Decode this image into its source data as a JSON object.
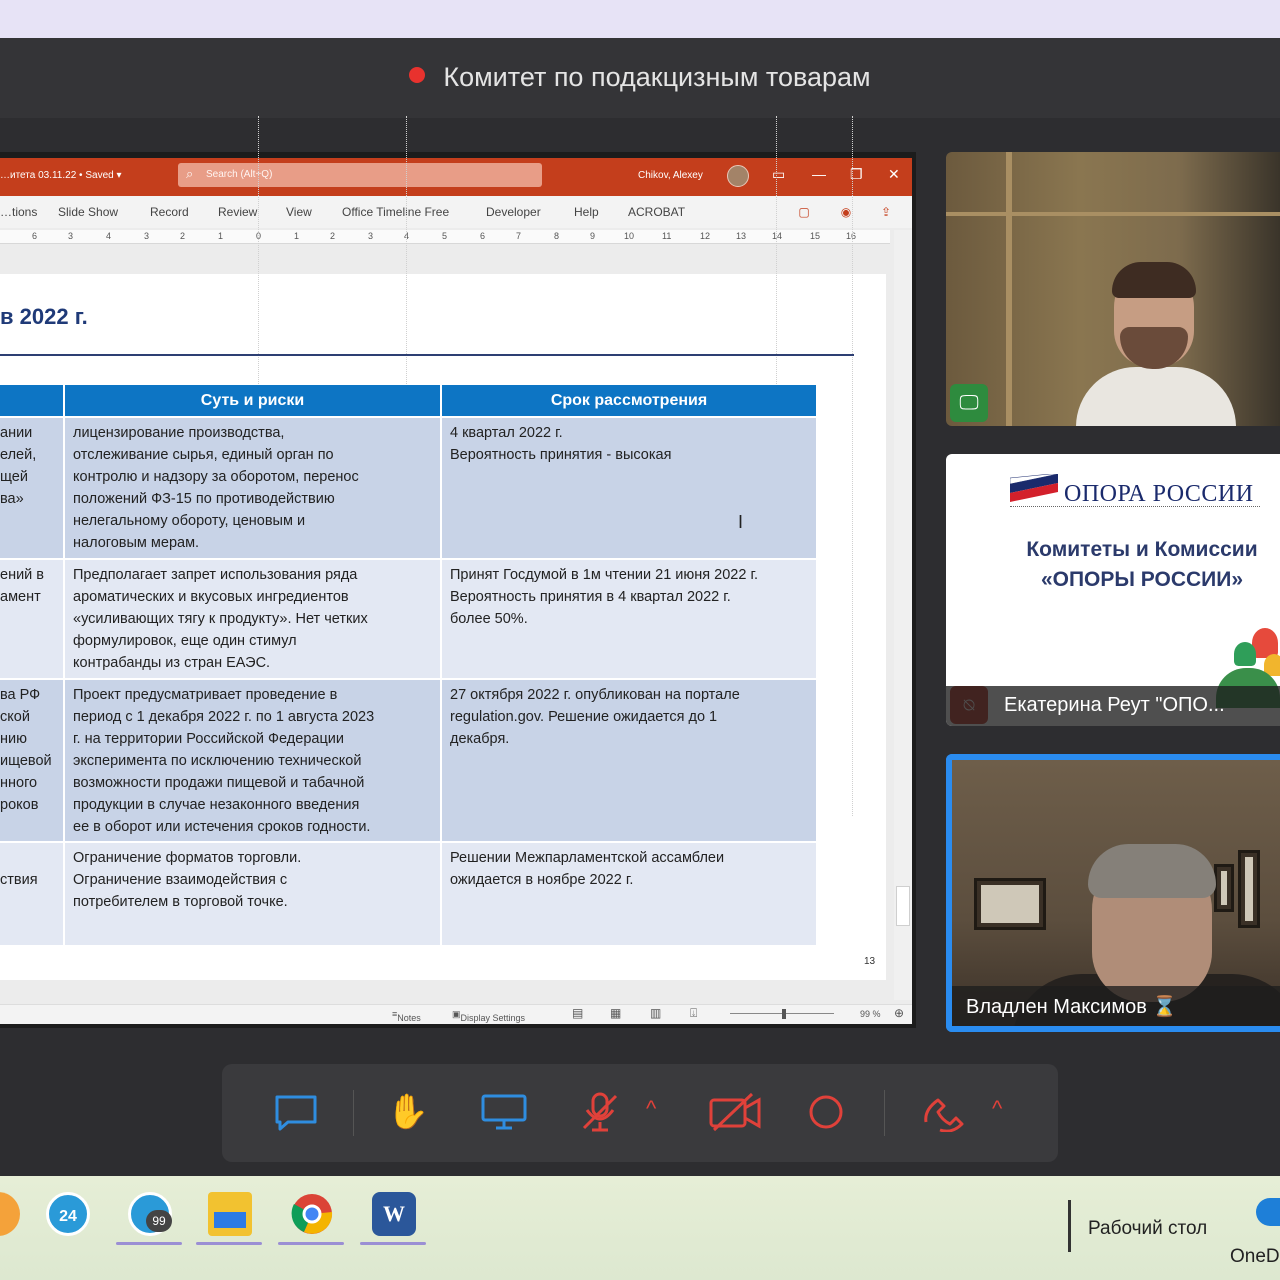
{
  "meeting": {
    "title": "Комитет по подакцизным товарам"
  },
  "powerpoint": {
    "file_name": "…итета 03.11.22 • Saved ▾",
    "search_placeholder": "Search (Alt+Q)",
    "user_name": "Chikov, Alexey",
    "menu": [
      "…tions",
      "Slide Show",
      "Record",
      "Review",
      "View",
      "Office Timeline Free",
      "Developer",
      "Help",
      "ACROBAT"
    ],
    "ruler_ticks": [
      "6",
      "3",
      "4",
      "3",
      "2",
      "1",
      "0",
      "1",
      "2",
      "3",
      "4",
      "5",
      "6",
      "7",
      "8",
      "9",
      "10",
      "11",
      "12",
      "13",
      "14",
      "15",
      "16"
    ],
    "status": {
      "notes": "Notes",
      "display_settings": "Display Settings",
      "zoom": "99 %"
    },
    "page_number": "13"
  },
  "slide": {
    "heading": "в 2022 г.",
    "columns": [
      "",
      "Суть и риски",
      "Срок рассмотрения"
    ],
    "rows": [
      {
        "c0": "ании\nелей,\nщей\nва»",
        "c1": "лицензирование производства,\nотслеживание сырья, единый орган по\nконтролю и надзору за оборотом, перенос\nположений ФЗ-15 по противодействию\nнелегальному обороту, ценовым и\nналоговым мерам.",
        "c2": "4 квартал 2022 г.\nВероятность принятия - высокая"
      },
      {
        "c0": "ений в\nамент",
        "c1": "Предполагает запрет использования ряда\nароматических и вкусовых ингредиентов\n«усиливающих тягу к продукту». Нет четких\nформулировок, еще один стимул\nконтрабанды из стран ЕАЭС.",
        "c2": "Принят Госдумой в 1м чтении 21 июня 2022 г.\nВероятность принятия в 4 квартал 2022 г.\nболее 50%."
      },
      {
        "c0": "ва РФ\nской\nнию\nищевой\nнного\nроков",
        "c1": "Проект предусматривает проведение в\nпериод с 1 декабря 2022 г. по 1 августа 2023\nг. на территории Российской Федерации\nэксперимента по исключению технической\nвозможности продажи пищевой и табачной\nпродукции в случае незаконного введения\nее в оборот или истечения сроков годности.",
        "c2": "27 октября 2022 г. опубликован на портале\nregulation.gov. Решение ожидается до 1\nдекабря."
      },
      {
        "c0": "\nствия",
        "c1": "Ограничение форматов торговли.\nОграничение взаимодействия с\nпотребителем в торговой точке.",
        "c2": "Решении Межпарламентской ассамблеи\nожидается в ноябре 2022 г."
      }
    ]
  },
  "participants": {
    "tile2": {
      "logo_text": "ОПОРА РОССИИ",
      "line1": "Комитеты и Комиссии",
      "line2": "«ОПОРЫ РОССИИ»",
      "name": "Екатерина Реут \"ОПО..."
    },
    "tile3": {
      "name": "Владлен Максимов ⌛"
    }
  },
  "taskbar": {
    "badge1": "24",
    "badge2": "99",
    "desktop_label": "Рабочий стол",
    "onedrive_label": "OneD"
  },
  "colors": {
    "ppt_accent": "#c43e1c",
    "table_header": "#0d75c4",
    "active_speaker": "#2a8cf0",
    "control_blue": "#2f8de0",
    "control_red": "#e0413a"
  }
}
